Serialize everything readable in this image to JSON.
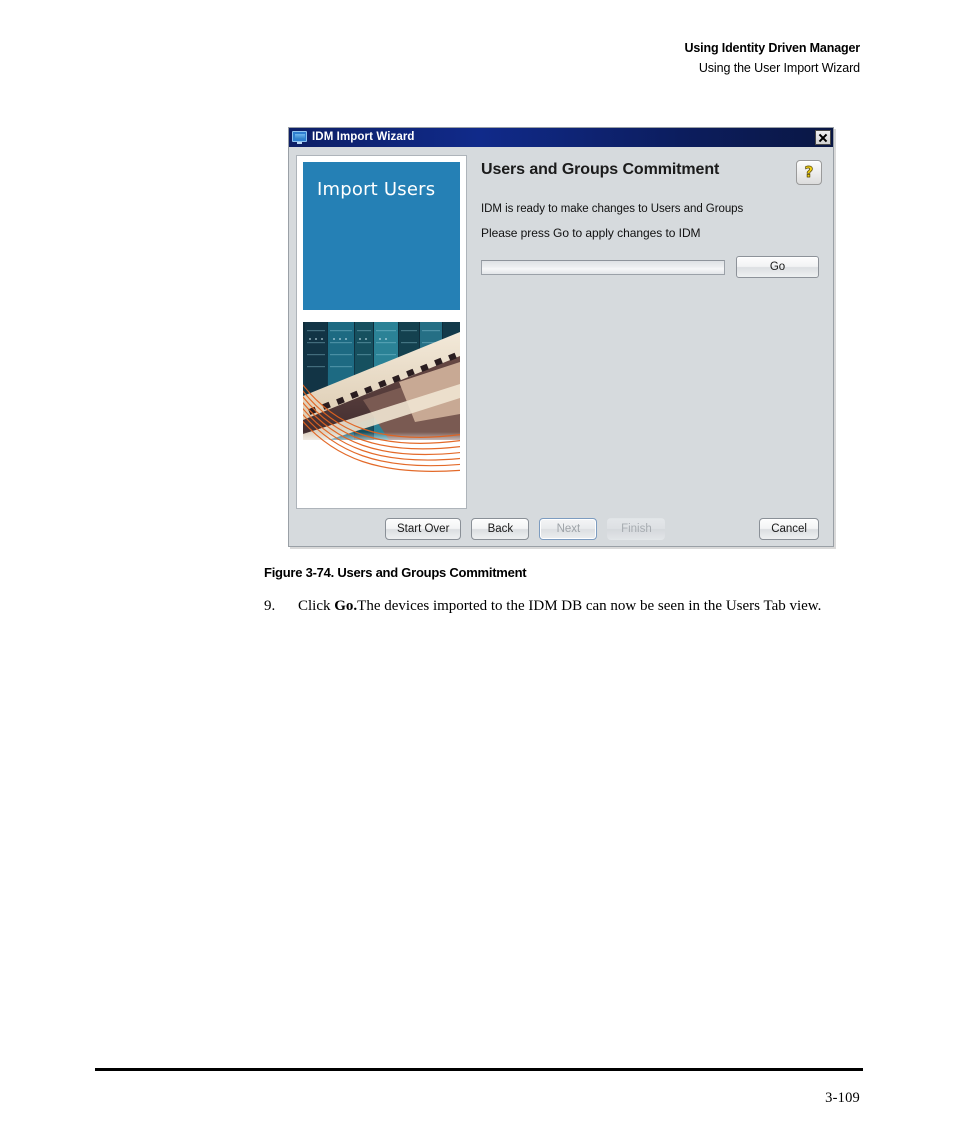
{
  "page": {
    "running_head_line1": "Using Identity Driven Manager",
    "running_head_line2": "Using the User Import Wizard",
    "figure_caption": "Figure 3-74. Users and Groups Commitment",
    "page_number": "3-109"
  },
  "step": {
    "number": "9.",
    "text_before_bold": "Click ",
    "bold": "Go.",
    "text_after_bold": "The devices imported to the IDM DB can now be seen in the Users Tab view."
  },
  "dialog": {
    "titlebar": {
      "title": "IDM Import Wizard",
      "icon": "monitor-icon",
      "close_label": "Close"
    },
    "sidebar": {
      "brand_text": "Import Users",
      "brand_color": "#2580b5",
      "photo_alt": "highway-overpass-photo"
    },
    "content": {
      "title": "Users and Groups Commitment",
      "help_label": "?",
      "body_line1": "IDM is ready to make changes to Users and Groups",
      "body_line2": "Please press Go to apply changes to IDM",
      "progress_value": 0,
      "go_label": "Go"
    },
    "buttons": [
      {
        "label": "Start Over",
        "state": "enabled"
      },
      {
        "label": "Back",
        "state": "enabled"
      },
      {
        "label": "Next",
        "state": "focused"
      },
      {
        "label": "Finish",
        "state": "disabled"
      },
      {
        "label": "Cancel",
        "state": "enabled"
      }
    ]
  }
}
